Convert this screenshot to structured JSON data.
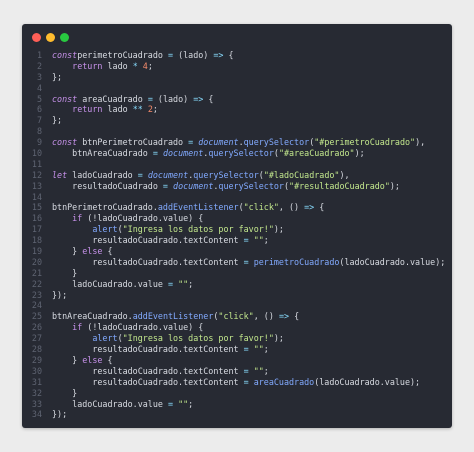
{
  "window": {
    "controls": [
      "close",
      "minimize",
      "maximize"
    ]
  },
  "code": {
    "lines": [
      {
        "n": "1",
        "parts": [
          [
            "kw",
            "const"
          ],
          [
            "",
            "perimetroCuadrado"
          ],
          [
            "op",
            " = "
          ],
          [
            "",
            "(lado) "
          ],
          [
            "op",
            "=>"
          ],
          [
            "",
            " {"
          ]
        ]
      },
      {
        "n": "2",
        "parts": [
          [
            "",
            "    "
          ],
          [
            "kw2",
            "return"
          ],
          [
            "",
            " lado "
          ],
          [
            "op",
            "*"
          ],
          [
            "num",
            " 4"
          ],
          [
            "",
            ";"
          ]
        ]
      },
      {
        "n": "3",
        "parts": [
          [
            "",
            "};"
          ]
        ]
      },
      {
        "n": "4",
        "parts": []
      },
      {
        "n": "5",
        "parts": [
          [
            "kw",
            "const"
          ],
          [
            "",
            " areaCuadrado"
          ],
          [
            "op",
            " = "
          ],
          [
            "",
            "(lado) "
          ],
          [
            "op",
            "=>"
          ],
          [
            "",
            " {"
          ]
        ]
      },
      {
        "n": "6",
        "parts": [
          [
            "",
            "    "
          ],
          [
            "kw2",
            "return"
          ],
          [
            "",
            " lado "
          ],
          [
            "op",
            "**"
          ],
          [
            "num",
            " 2"
          ],
          [
            "",
            ";"
          ]
        ]
      },
      {
        "n": "7",
        "parts": [
          [
            "",
            "};"
          ]
        ]
      },
      {
        "n": "8",
        "parts": []
      },
      {
        "n": "9",
        "parts": [
          [
            "kw",
            "const"
          ],
          [
            "",
            " btnPerimetroCuadrado"
          ],
          [
            "op",
            " = "
          ],
          [
            "glob",
            "document"
          ],
          [
            "",
            "."
          ],
          [
            "fn",
            "querySelector"
          ],
          [
            "",
            "("
          ],
          [
            "str",
            "\"#perimetroCuadrado\""
          ],
          [
            "",
            "),"
          ]
        ]
      },
      {
        "n": "10",
        "parts": [
          [
            "",
            "    btnAreaCuadrado"
          ],
          [
            "op",
            " = "
          ],
          [
            "glob",
            "document"
          ],
          [
            "",
            "."
          ],
          [
            "fn",
            "querySelector"
          ],
          [
            "",
            "("
          ],
          [
            "str",
            "\"#areaCuadrado\""
          ],
          [
            "",
            ");"
          ]
        ]
      },
      {
        "n": "11",
        "parts": []
      },
      {
        "n": "12",
        "parts": [
          [
            "kw",
            "let"
          ],
          [
            "",
            " ladoCuadrado"
          ],
          [
            "op",
            " = "
          ],
          [
            "glob",
            "document"
          ],
          [
            "",
            "."
          ],
          [
            "fn",
            "querySelector"
          ],
          [
            "",
            "("
          ],
          [
            "str",
            "\"#ladoCuadrado\""
          ],
          [
            "",
            "),"
          ]
        ]
      },
      {
        "n": "13",
        "parts": [
          [
            "",
            "    resultadoCuadrado"
          ],
          [
            "op",
            " = "
          ],
          [
            "glob",
            "document"
          ],
          [
            "",
            "."
          ],
          [
            "fn",
            "querySelector"
          ],
          [
            "",
            "("
          ],
          [
            "str",
            "\"#resultadoCuadrado\""
          ],
          [
            "",
            ");"
          ]
        ]
      },
      {
        "n": "14",
        "parts": []
      },
      {
        "n": "15",
        "parts": [
          [
            "",
            "btnPerimetroCuadrado."
          ],
          [
            "fn",
            "addEventListener"
          ],
          [
            "",
            "("
          ],
          [
            "str",
            "\"click\""
          ],
          [
            "",
            ", () "
          ],
          [
            "op",
            "=>"
          ],
          [
            "",
            " {"
          ]
        ]
      },
      {
        "n": "16",
        "parts": [
          [
            "",
            "    "
          ],
          [
            "kw2",
            "if"
          ],
          [
            "",
            " (!ladoCuadrado.value) {"
          ]
        ]
      },
      {
        "n": "17",
        "parts": [
          [
            "",
            "        "
          ],
          [
            "fn",
            "alert"
          ],
          [
            "",
            "("
          ],
          [
            "str",
            "\"Ingresa los datos por favor!\""
          ],
          [
            "",
            ");"
          ]
        ]
      },
      {
        "n": "18",
        "parts": [
          [
            "",
            "        resultadoCuadrado.textContent"
          ],
          [
            "op",
            " = "
          ],
          [
            "str",
            "\"\""
          ],
          [
            "",
            ";"
          ]
        ]
      },
      {
        "n": "19",
        "parts": [
          [
            "",
            "    } "
          ],
          [
            "kw2",
            "else"
          ],
          [
            "",
            " {"
          ]
        ]
      },
      {
        "n": "20",
        "parts": [
          [
            "",
            "        resultadoCuadrado.textContent"
          ],
          [
            "op",
            " = "
          ],
          [
            "fn",
            "perimetroCuadrado"
          ],
          [
            "",
            "(ladoCuadrado.value);"
          ]
        ]
      },
      {
        "n": "21",
        "parts": [
          [
            "",
            "    }"
          ]
        ]
      },
      {
        "n": "22",
        "parts": [
          [
            "",
            "    ladoCuadrado.value"
          ],
          [
            "op",
            " = "
          ],
          [
            "str",
            "\"\""
          ],
          [
            "",
            ";"
          ]
        ]
      },
      {
        "n": "23",
        "parts": [
          [
            "",
            "});"
          ]
        ]
      },
      {
        "n": "24",
        "parts": []
      },
      {
        "n": "25",
        "parts": [
          [
            "",
            "btnAreaCuadrado."
          ],
          [
            "fn",
            "addEventListener"
          ],
          [
            "",
            "("
          ],
          [
            "str",
            "\"click\""
          ],
          [
            "",
            ", () "
          ],
          [
            "op",
            "=>"
          ],
          [
            "",
            " {"
          ]
        ]
      },
      {
        "n": "26",
        "parts": [
          [
            "",
            "    "
          ],
          [
            "kw2",
            "if"
          ],
          [
            "",
            " (!ladoCuadrado.value) {"
          ]
        ]
      },
      {
        "n": "27",
        "parts": [
          [
            "",
            "        "
          ],
          [
            "fn",
            "alert"
          ],
          [
            "",
            "("
          ],
          [
            "str",
            "\"Ingresa los datos por favor!\""
          ],
          [
            "",
            ");"
          ]
        ]
      },
      {
        "n": "28",
        "parts": [
          [
            "",
            "        resultadoCuadrado.textContent"
          ],
          [
            "op",
            " = "
          ],
          [
            "str",
            "\"\""
          ],
          [
            "",
            ";"
          ]
        ]
      },
      {
        "n": "29",
        "parts": [
          [
            "",
            "    } "
          ],
          [
            "kw2",
            "else"
          ],
          [
            "",
            " {"
          ]
        ]
      },
      {
        "n": "30",
        "parts": [
          [
            "",
            "        resultadoCuadrado.textContent"
          ],
          [
            "op",
            " = "
          ],
          [
            "str",
            "\"\""
          ],
          [
            "",
            ";"
          ]
        ]
      },
      {
        "n": "31",
        "parts": [
          [
            "",
            "        resultadoCuadrado.textContent"
          ],
          [
            "op",
            " = "
          ],
          [
            "fn",
            "areaCuadrado"
          ],
          [
            "",
            "(ladoCuadrado.value);"
          ]
        ]
      },
      {
        "n": "32",
        "parts": [
          [
            "",
            "    }"
          ]
        ]
      },
      {
        "n": "33",
        "parts": [
          [
            "",
            "    ladoCuadrado.value"
          ],
          [
            "op",
            " = "
          ],
          [
            "str",
            "\"\""
          ],
          [
            "",
            ";"
          ]
        ]
      },
      {
        "n": "34",
        "parts": [
          [
            "",
            "});"
          ]
        ]
      }
    ]
  },
  "colors": {
    "background": "#ececec",
    "editor": "#272a33",
    "close": "#ff5f57",
    "minimize": "#febc2e",
    "maximize": "#28c840"
  }
}
